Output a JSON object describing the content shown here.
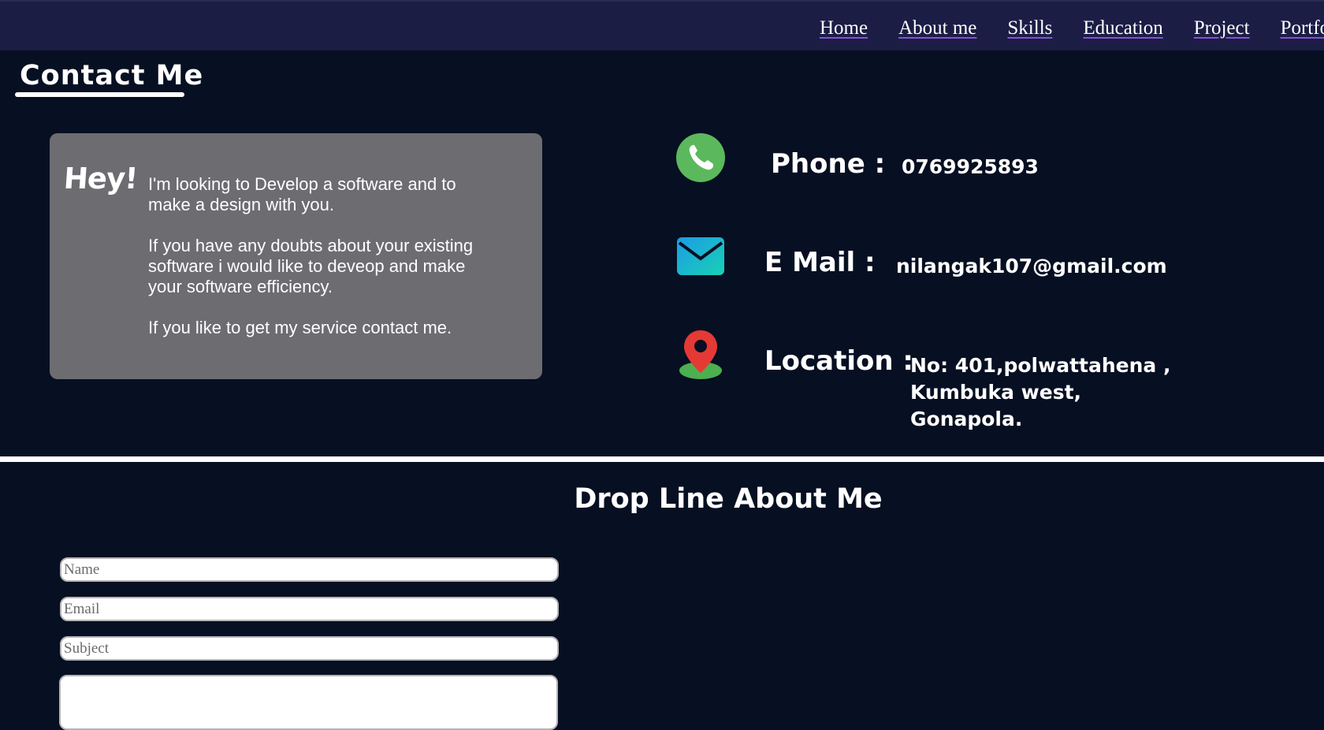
{
  "nav": {
    "items": [
      "Home",
      "About me",
      "Skills",
      "Education",
      "Project",
      "Portfolio"
    ]
  },
  "contact": {
    "title": "Contact Me",
    "hey": "Hey!",
    "intro_paragraphs": [
      "I'm looking to Develop a software and to make a design with you.",
      "If you have any doubts about your existing software i would like to deveop and make your software efficiency.",
      "If you like to get my service contact me."
    ],
    "phone": {
      "label": "Phone :",
      "value": "0769925893",
      "icon": "phone-icon"
    },
    "email": {
      "label": "E Mail :",
      "value": "nilangak107@gmail.com",
      "icon": "mail-icon"
    },
    "location": {
      "label": "Location :",
      "lines": [
        "No: 401,polwattahena ,",
        "Kumbuka west,",
        "Gonapola."
      ],
      "icon": "location-pin-icon"
    }
  },
  "drop_line": {
    "title": "Drop Line About Me",
    "name_placeholder": "Name",
    "email_placeholder": "Email",
    "subject_placeholder": "Subject",
    "message_value": ""
  },
  "colors": {
    "background": "#070f22",
    "nav_background": "#1b1d45",
    "card_background": "#6d6c71",
    "phone_icon": "#5cb85c",
    "mail_icon": "#19c6c6",
    "pin_icon": "#e53935"
  }
}
